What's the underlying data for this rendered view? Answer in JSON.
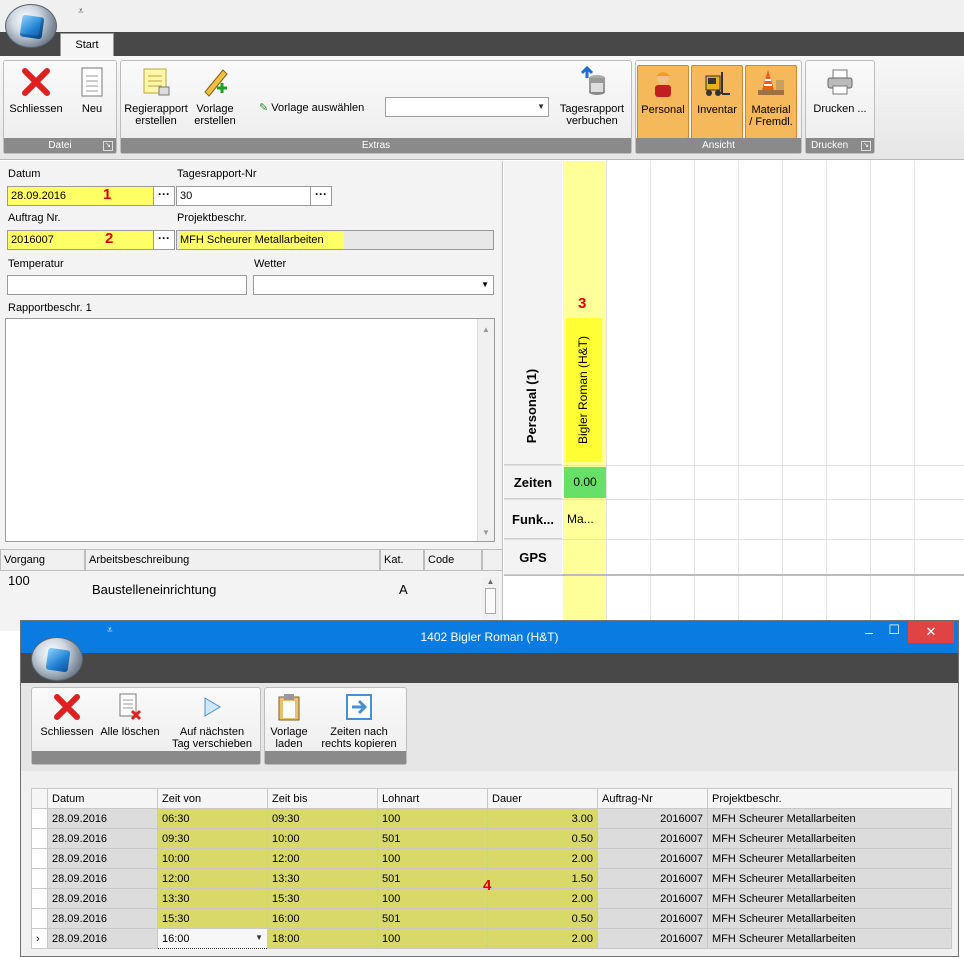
{
  "app": {
    "qat_symbol": "⩡",
    "start_tab": "Start"
  },
  "ribbon": {
    "datei": {
      "label": "Datei",
      "schliessen": "Schliessen",
      "neu": "Neu"
    },
    "extras": {
      "label": "Extras",
      "regierapport_1": "Regierapport",
      "regierapport_2": "erstellen",
      "vorlage_1": "Vorlage",
      "vorlage_2": "erstellen",
      "vorlage_auswaehlen": "Vorlage auswählen",
      "vorlage_combo_value": "",
      "tagesrapport_1": "Tagesrapport",
      "tagesrapport_2": "verbuchen"
    },
    "ansicht": {
      "label": "Ansicht",
      "personal": "Personal",
      "inventar": "Inventar",
      "material_1": "Material",
      "material_2": "/ Fremdl."
    },
    "drucken": {
      "label": "Drucken",
      "drucken": "Drucken ..."
    }
  },
  "form": {
    "datum_label": "Datum",
    "datum_value": "28.09.2016",
    "marker1": "1",
    "tagesrapport_label": "Tagesrapport-Nr",
    "tagesrapport_value": "30",
    "auftrag_label": "Auftrag Nr.",
    "auftrag_value": "2016007",
    "marker2": "2",
    "projekt_label": "Projektbeschr.",
    "projekt_value": "MFH Scheurer Metallarbeiten",
    "temperatur_label": "Temperatur",
    "temperatur_value": "",
    "wetter_label": "Wetter",
    "wetter_value": "",
    "rapport_label": "Rapportbeschr. 1",
    "rapport_value": "",
    "dots": "···"
  },
  "activity_grid": {
    "headers": [
      "Vorgang",
      "Arbeitsbeschreibung",
      "Kat.",
      "Code"
    ],
    "rows": [
      {
        "vorgang": "100",
        "beschreibung": "Baustelleneinrichtung",
        "kat": "A",
        "code": ""
      }
    ]
  },
  "schedule": {
    "marker3": "3",
    "personal_label": "Personal (1)",
    "person_name": "Bigler Roman (H&T)",
    "zeiten_label": "Zeiten",
    "zeiten_value": "0.00",
    "funk_label": "Funk...",
    "funk_value": "Ma...",
    "gps_label": "GPS"
  },
  "popup": {
    "title": "1402 Bigler Roman (H&T)",
    "buttons": {
      "schliessen": "Schliessen",
      "alle_loeschen": "Alle löschen",
      "auf_naechsten_1": "Auf nächsten",
      "auf_naechsten_2": "Tag verschieben",
      "vorlage_1": "Vorlage",
      "vorlage_2": "laden",
      "zeiten_1": "Zeiten nach",
      "zeiten_2": "rechts kopieren"
    },
    "marker4": "4",
    "table": {
      "headers": [
        "Datum",
        "Zeit von",
        "Zeit bis",
        "Lohnart",
        "Dauer",
        "Auftrag-Nr",
        "Projektbeschr."
      ],
      "rows": [
        [
          "28.09.2016",
          "06:30",
          "09:30",
          "100",
          "3.00",
          "2016007",
          "MFH Scheurer Metallarbeiten"
        ],
        [
          "28.09.2016",
          "09:30",
          "10:00",
          "501",
          "0.50",
          "2016007",
          "MFH Scheurer Metallarbeiten"
        ],
        [
          "28.09.2016",
          "10:00",
          "12:00",
          "100",
          "2.00",
          "2016007",
          "MFH Scheurer Metallarbeiten"
        ],
        [
          "28.09.2016",
          "12:00",
          "13:30",
          "501",
          "1.50",
          "2016007",
          "MFH Scheurer Metallarbeiten"
        ],
        [
          "28.09.2016",
          "13:30",
          "15:30",
          "100",
          "2.00",
          "2016007",
          "MFH Scheurer Metallarbeiten"
        ],
        [
          "28.09.2016",
          "15:30",
          "16:00",
          "501",
          "0.50",
          "2016007",
          "MFH Scheurer Metallarbeiten"
        ],
        [
          "28.09.2016",
          "16:00",
          "18:00",
          "100",
          "2.00",
          "2016007",
          "MFH Scheurer Metallarbeiten"
        ]
      ]
    }
  },
  "colors": {
    "highlight": "#ffff66",
    "title_blue": "#0a7be0",
    "close_red": "#e04343",
    "zeiten_green": "#66e066"
  }
}
